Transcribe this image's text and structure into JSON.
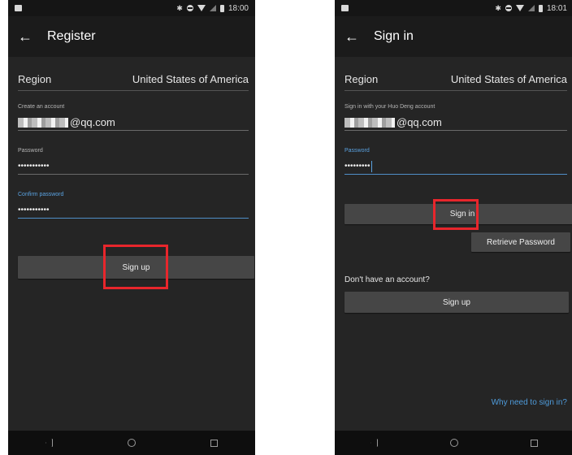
{
  "left_screen": {
    "status_bar": {
      "time": "18:00"
    },
    "app_bar": {
      "title": "Register"
    },
    "region": {
      "label": "Region",
      "value": "United States of America"
    },
    "account_field": {
      "caption": "Create an account",
      "value_suffix": "@qq.com"
    },
    "password_field": {
      "caption": "Password",
      "value": "•••••••••••"
    },
    "confirm_field": {
      "caption": "Confirm password",
      "value": "•••••••••••"
    },
    "signup_button": {
      "label": "Sign up"
    },
    "nav_icons": [
      "back-icon",
      "home-icon",
      "recents-icon"
    ]
  },
  "right_screen": {
    "status_bar": {
      "time": "18:01"
    },
    "app_bar": {
      "title": "Sign in"
    },
    "region": {
      "label": "Region",
      "value": "United States of America"
    },
    "account_field": {
      "caption": "Sign in with your Huo Deng account",
      "value_suffix": "@qq.com"
    },
    "password_field": {
      "caption": "Password",
      "value": "•••••••••"
    },
    "signin_button": {
      "label": "Sign in"
    },
    "retrieve_button": {
      "label": "Retrieve Password"
    },
    "no_account_text": "Don't have an account?",
    "signup_button": {
      "label": "Sign up"
    },
    "why_link": "Why need to sign in?",
    "nav_icons": [
      "back-icon",
      "home-icon",
      "recents-icon"
    ]
  },
  "colors": {
    "highlight": "#e8262c",
    "accent": "#4e9bdb",
    "background": "#252525"
  }
}
